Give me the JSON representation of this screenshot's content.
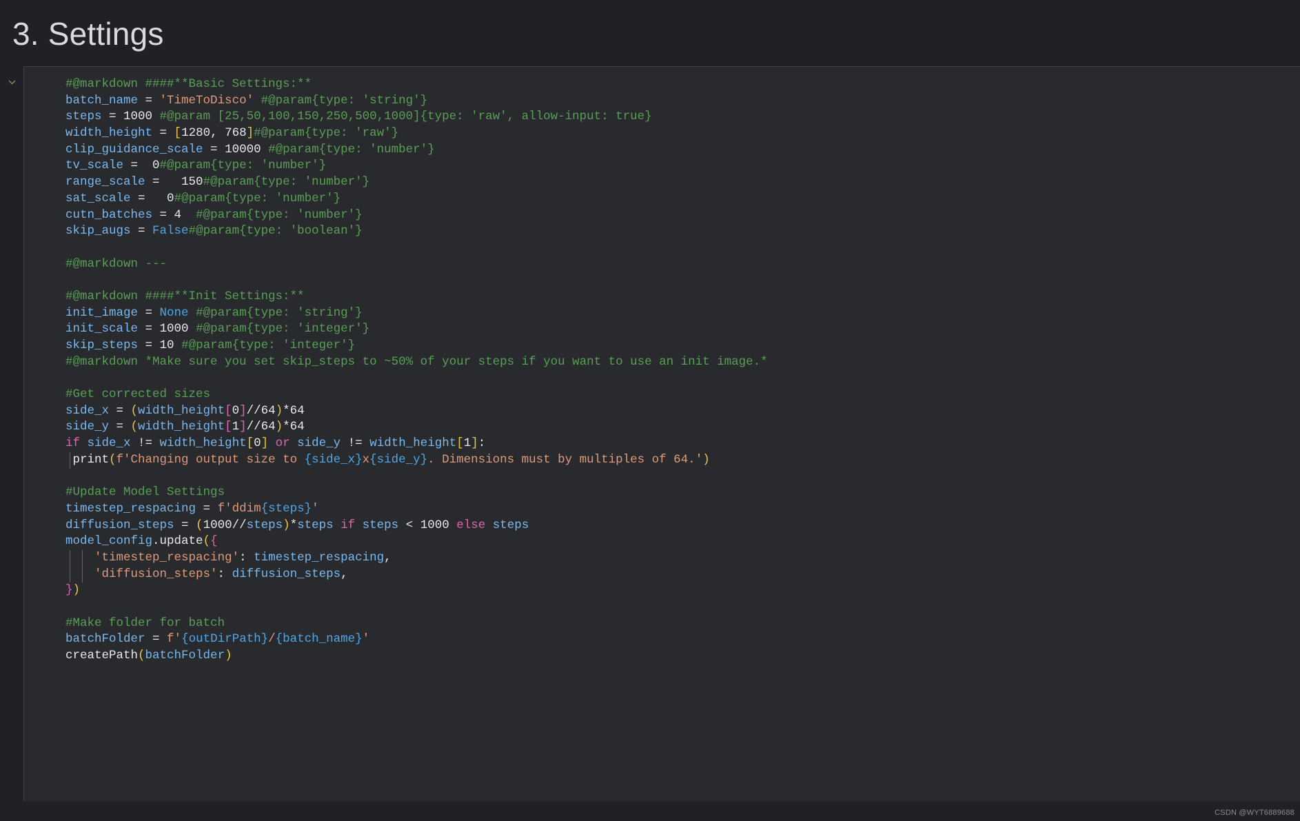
{
  "page": {
    "background_color": "#202124",
    "title": "3. Settings"
  },
  "cell": {
    "background_color": "#282a2d",
    "border_color": "#3c4043",
    "collapse_icon": "chevron-down-icon"
  },
  "colors": {
    "comment": "#5a9e57",
    "variable": "#79b8f0",
    "string": "#e2997a",
    "keyword": "#e066b0",
    "boolean": "#4fa6e8",
    "bracket_yellow": "#e8c547",
    "bracket_magenta": "#e060b0",
    "bracket_blue": "#4fa6e8",
    "plain": "#e8eaed"
  },
  "code": {
    "language": "python",
    "lines": [
      {
        "tokens": [
          {
            "t": "#@markdown ####**Basic Settings:**",
            "c": "c-com"
          }
        ]
      },
      {
        "tokens": [
          {
            "t": "batch_name ",
            "c": "c-var"
          },
          {
            "t": "= ",
            "c": "c-plain"
          },
          {
            "t": "'TimeToDisco' ",
            "c": "c-str"
          },
          {
            "t": "#@param{type: 'string'}",
            "c": "c-com"
          }
        ]
      },
      {
        "tokens": [
          {
            "t": "steps ",
            "c": "c-var"
          },
          {
            "t": "= ",
            "c": "c-plain"
          },
          {
            "t": "1000 ",
            "c": "c-num"
          },
          {
            "t": "#@param [25,50,100,150,250,500,1000]{type: 'raw', allow-input: true}",
            "c": "c-com"
          }
        ]
      },
      {
        "tokens": [
          {
            "t": "width_height ",
            "c": "c-var"
          },
          {
            "t": "= ",
            "c": "c-plain"
          },
          {
            "t": "[",
            "c": "c-par1"
          },
          {
            "t": "1280, 768",
            "c": "c-num"
          },
          {
            "t": "]",
            "c": "c-par1"
          },
          {
            "t": "#@param{type: 'raw'}",
            "c": "c-com"
          }
        ]
      },
      {
        "tokens": [
          {
            "t": "clip_guidance_scale ",
            "c": "c-var"
          },
          {
            "t": "= ",
            "c": "c-plain"
          },
          {
            "t": "10000 ",
            "c": "c-num"
          },
          {
            "t": "#@param{type: 'number'}",
            "c": "c-com"
          }
        ]
      },
      {
        "tokens": [
          {
            "t": "tv_scale ",
            "c": "c-var"
          },
          {
            "t": "=  ",
            "c": "c-plain"
          },
          {
            "t": "0",
            "c": "c-num"
          },
          {
            "t": "#@param{type: 'number'}",
            "c": "c-com"
          }
        ]
      },
      {
        "tokens": [
          {
            "t": "range_scale ",
            "c": "c-var"
          },
          {
            "t": "=   ",
            "c": "c-plain"
          },
          {
            "t": "150",
            "c": "c-num"
          },
          {
            "t": "#@param{type: 'number'}",
            "c": "c-com"
          }
        ]
      },
      {
        "tokens": [
          {
            "t": "sat_scale ",
            "c": "c-var"
          },
          {
            "t": "=   ",
            "c": "c-plain"
          },
          {
            "t": "0",
            "c": "c-num"
          },
          {
            "t": "#@param{type: 'number'}",
            "c": "c-com"
          }
        ]
      },
      {
        "tokens": [
          {
            "t": "cutn_batches ",
            "c": "c-var"
          },
          {
            "t": "= ",
            "c": "c-plain"
          },
          {
            "t": "4  ",
            "c": "c-num"
          },
          {
            "t": "#@param{type: 'number'}",
            "c": "c-com"
          }
        ]
      },
      {
        "tokens": [
          {
            "t": "skip_augs ",
            "c": "c-var"
          },
          {
            "t": "= ",
            "c": "c-plain"
          },
          {
            "t": "False",
            "c": "c-bool"
          },
          {
            "t": "#@param{type: 'boolean'}",
            "c": "c-com"
          }
        ]
      },
      {
        "tokens": []
      },
      {
        "tokens": [
          {
            "t": "#@markdown ---",
            "c": "c-com"
          }
        ]
      },
      {
        "tokens": []
      },
      {
        "tokens": [
          {
            "t": "#@markdown ####**Init Settings:**",
            "c": "c-com"
          }
        ]
      },
      {
        "tokens": [
          {
            "t": "init_image ",
            "c": "c-var"
          },
          {
            "t": "= ",
            "c": "c-plain"
          },
          {
            "t": "None ",
            "c": "c-bool"
          },
          {
            "t": "#@param{type: 'string'}",
            "c": "c-com"
          }
        ]
      },
      {
        "tokens": [
          {
            "t": "init_scale ",
            "c": "c-var"
          },
          {
            "t": "= ",
            "c": "c-plain"
          },
          {
            "t": "1000 ",
            "c": "c-num"
          },
          {
            "t": "#@param{type: 'integer'}",
            "c": "c-com"
          }
        ]
      },
      {
        "tokens": [
          {
            "t": "skip_steps ",
            "c": "c-var"
          },
          {
            "t": "= ",
            "c": "c-plain"
          },
          {
            "t": "10 ",
            "c": "c-num"
          },
          {
            "t": "#@param{type: 'integer'}",
            "c": "c-com"
          }
        ]
      },
      {
        "tokens": [
          {
            "t": "#@markdown *Make sure you set skip_steps to ~50% of your steps if you want to use an init image.*",
            "c": "c-com"
          }
        ]
      },
      {
        "tokens": []
      },
      {
        "tokens": [
          {
            "t": "#Get corrected sizes",
            "c": "c-com"
          }
        ]
      },
      {
        "tokens": [
          {
            "t": "side_x ",
            "c": "c-var"
          },
          {
            "t": "= ",
            "c": "c-plain"
          },
          {
            "t": "(",
            "c": "c-par1"
          },
          {
            "t": "width_height",
            "c": "c-var"
          },
          {
            "t": "[",
            "c": "c-par2"
          },
          {
            "t": "0",
            "c": "c-num"
          },
          {
            "t": "]",
            "c": "c-par2"
          },
          {
            "t": "//64",
            "c": "c-plain"
          },
          {
            "t": ")",
            "c": "c-par1"
          },
          {
            "t": "*64",
            "c": "c-plain"
          }
        ]
      },
      {
        "tokens": [
          {
            "t": "side_y ",
            "c": "c-var"
          },
          {
            "t": "= ",
            "c": "c-plain"
          },
          {
            "t": "(",
            "c": "c-par1"
          },
          {
            "t": "width_height",
            "c": "c-var"
          },
          {
            "t": "[",
            "c": "c-par2"
          },
          {
            "t": "1",
            "c": "c-num"
          },
          {
            "t": "]",
            "c": "c-par2"
          },
          {
            "t": "//64",
            "c": "c-plain"
          },
          {
            "t": ")",
            "c": "c-par1"
          },
          {
            "t": "*64",
            "c": "c-plain"
          }
        ]
      },
      {
        "tokens": [
          {
            "t": "if ",
            "c": "c-kw"
          },
          {
            "t": "side_x ",
            "c": "c-var"
          },
          {
            "t": "!= ",
            "c": "c-plain"
          },
          {
            "t": "width_height",
            "c": "c-var"
          },
          {
            "t": "[",
            "c": "c-par1"
          },
          {
            "t": "0",
            "c": "c-num"
          },
          {
            "t": "]",
            "c": "c-par1"
          },
          {
            "t": " ",
            "c": "c-plain"
          },
          {
            "t": "or ",
            "c": "c-kw"
          },
          {
            "t": "side_y ",
            "c": "c-var"
          },
          {
            "t": "!= ",
            "c": "c-plain"
          },
          {
            "t": "width_height",
            "c": "c-var"
          },
          {
            "t": "[",
            "c": "c-par1"
          },
          {
            "t": "1",
            "c": "c-num"
          },
          {
            "t": "]",
            "c": "c-par1"
          },
          {
            "t": ":",
            "c": "c-plain"
          }
        ],
        "indent_guides": 0
      },
      {
        "tokens": [
          {
            "t": " print",
            "c": "c-plain"
          },
          {
            "t": "(",
            "c": "c-par1"
          },
          {
            "t": "f'Changing output size to ",
            "c": "c-str"
          },
          {
            "t": "{side_x}",
            "c": "c-par3"
          },
          {
            "t": "x",
            "c": "c-str"
          },
          {
            "t": "{side_y}",
            "c": "c-par3"
          },
          {
            "t": ". Dimensions must by multiples of 64.'",
            "c": "c-str"
          },
          {
            "t": ")",
            "c": "c-par1"
          }
        ],
        "indent_guides": 1
      },
      {
        "tokens": []
      },
      {
        "tokens": [
          {
            "t": "#Update Model Settings",
            "c": "c-com"
          }
        ]
      },
      {
        "tokens": [
          {
            "t": "timestep_respacing ",
            "c": "c-var"
          },
          {
            "t": "= ",
            "c": "c-plain"
          },
          {
            "t": "f'ddim",
            "c": "c-str"
          },
          {
            "t": "{steps}",
            "c": "c-par3"
          },
          {
            "t": "'",
            "c": "c-str"
          }
        ]
      },
      {
        "tokens": [
          {
            "t": "diffusion_steps ",
            "c": "c-var"
          },
          {
            "t": "= ",
            "c": "c-plain"
          },
          {
            "t": "(",
            "c": "c-par1"
          },
          {
            "t": "1000",
            "c": "c-num"
          },
          {
            "t": "//",
            "c": "c-plain"
          },
          {
            "t": "steps",
            "c": "c-var"
          },
          {
            "t": ")",
            "c": "c-par1"
          },
          {
            "t": "*",
            "c": "c-plain"
          },
          {
            "t": "steps ",
            "c": "c-var"
          },
          {
            "t": "if ",
            "c": "c-kw"
          },
          {
            "t": "steps ",
            "c": "c-var"
          },
          {
            "t": "< ",
            "c": "c-plain"
          },
          {
            "t": "1000 ",
            "c": "c-num"
          },
          {
            "t": "else ",
            "c": "c-kw"
          },
          {
            "t": "steps",
            "c": "c-var"
          }
        ]
      },
      {
        "tokens": [
          {
            "t": "model_config",
            "c": "c-var"
          },
          {
            "t": ".update",
            "c": "c-plain"
          },
          {
            "t": "(",
            "c": "c-par1"
          },
          {
            "t": "{",
            "c": "c-par2"
          }
        ]
      },
      {
        "tokens": [
          {
            "t": "    'timestep_respacing'",
            "c": "c-str"
          },
          {
            "t": ": ",
            "c": "c-plain"
          },
          {
            "t": "timestep_respacing",
            "c": "c-var"
          },
          {
            "t": ",",
            "c": "c-plain"
          }
        ],
        "indent_guides": 2
      },
      {
        "tokens": [
          {
            "t": "    'diffusion_steps'",
            "c": "c-str"
          },
          {
            "t": ": ",
            "c": "c-plain"
          },
          {
            "t": "diffusion_steps",
            "c": "c-var"
          },
          {
            "t": ",",
            "c": "c-plain"
          }
        ],
        "indent_guides": 2
      },
      {
        "tokens": [
          {
            "t": "}",
            "c": "c-par2"
          },
          {
            "t": ")",
            "c": "c-par1"
          }
        ]
      },
      {
        "tokens": []
      },
      {
        "tokens": [
          {
            "t": "#Make folder for batch",
            "c": "c-com"
          }
        ]
      },
      {
        "tokens": [
          {
            "t": "batchFolder ",
            "c": "c-var"
          },
          {
            "t": "= ",
            "c": "c-plain"
          },
          {
            "t": "f'",
            "c": "c-str"
          },
          {
            "t": "{outDirPath}",
            "c": "c-par3"
          },
          {
            "t": "/",
            "c": "c-str"
          },
          {
            "t": "{batch_name}",
            "c": "c-par3"
          },
          {
            "t": "'",
            "c": "c-str"
          }
        ]
      },
      {
        "tokens": [
          {
            "t": "createPath",
            "c": "c-plain"
          },
          {
            "t": "(",
            "c": "c-par1"
          },
          {
            "t": "batchFolder",
            "c": "c-var"
          },
          {
            "t": ")",
            "c": "c-par1"
          }
        ]
      }
    ]
  },
  "watermark": "CSDN @WYT6889688"
}
